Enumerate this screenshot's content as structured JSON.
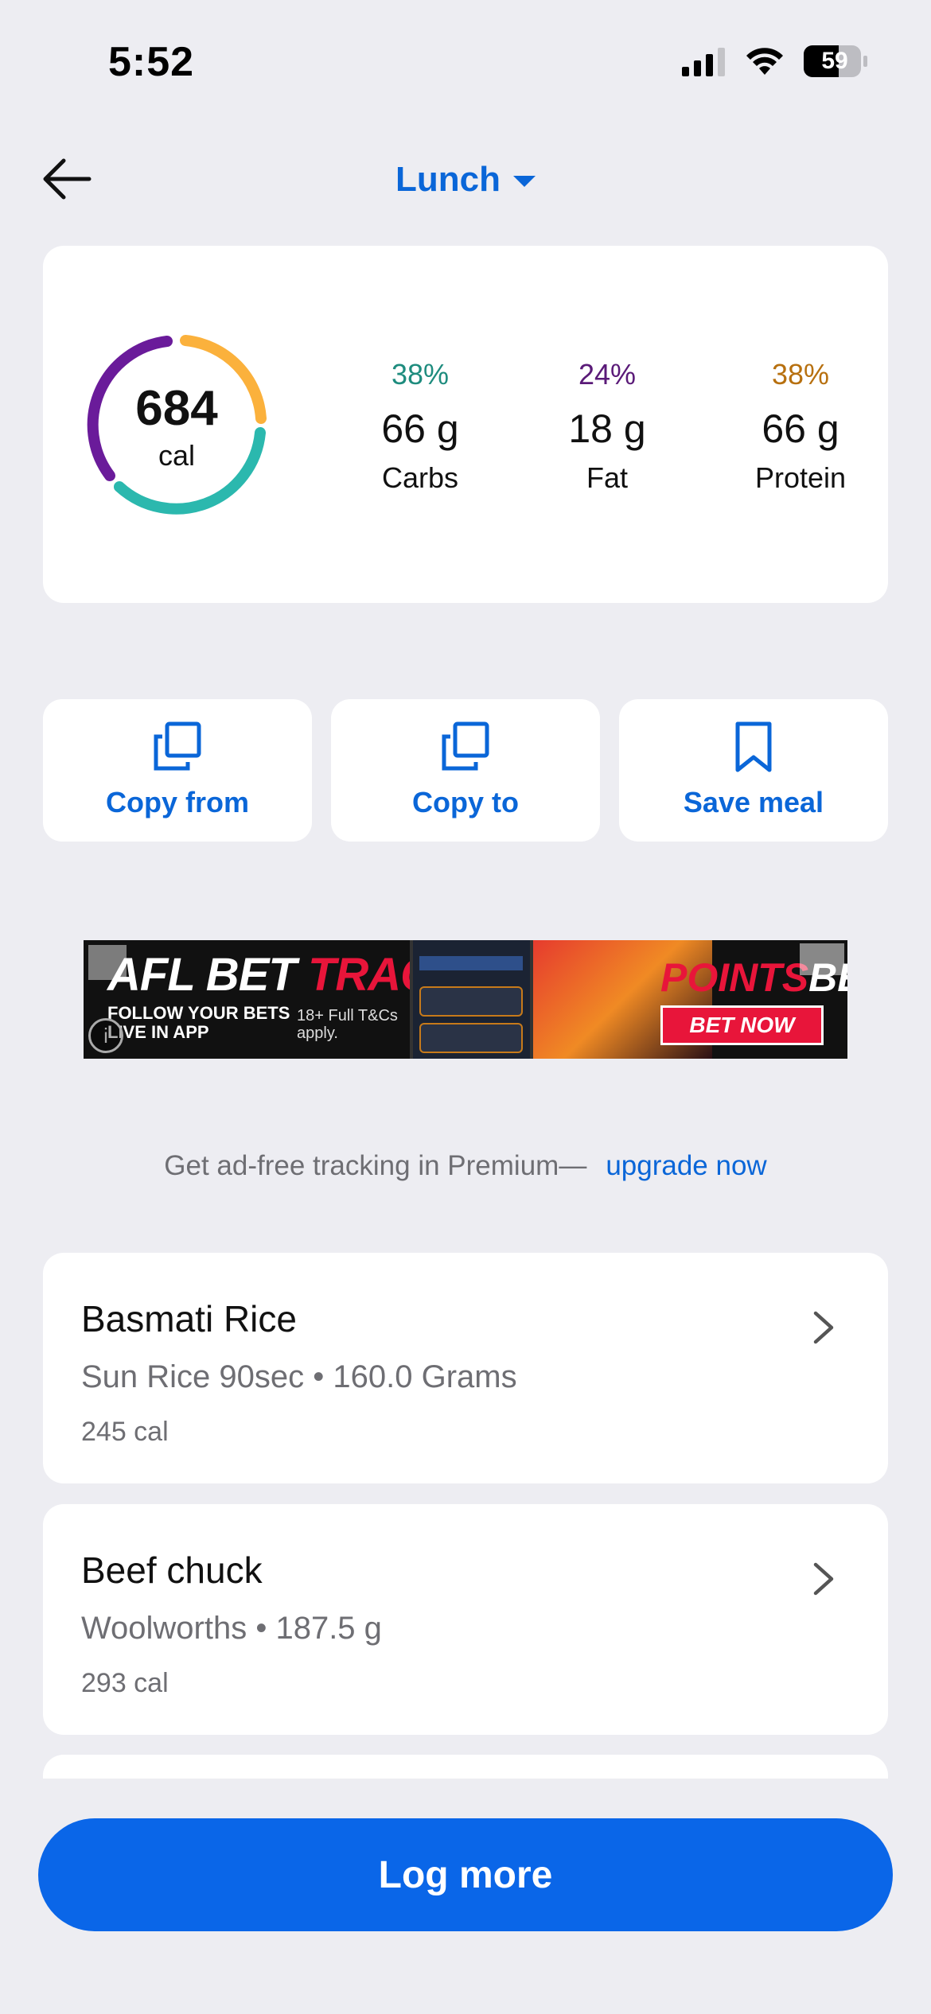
{
  "status_bar": {
    "time": "5:52",
    "battery": "59"
  },
  "header": {
    "meal_title": "Lunch"
  },
  "summary": {
    "calories": "684",
    "calories_unit": "cal",
    "macros": [
      {
        "pct": "38%",
        "value": "66 g",
        "name": "Carbs",
        "color": "#1E8C7E"
      },
      {
        "pct": "24%",
        "value": "18 g",
        "name": "Fat",
        "color": "#5A1A78"
      },
      {
        "pct": "38%",
        "value": "66 g",
        "name": "Protein",
        "color": "#B7700F"
      }
    ],
    "ring_colors": {
      "carbs": "#2BB8AE",
      "fat": "#6A1B9A",
      "protein": "#FBB13C"
    }
  },
  "actions": {
    "copy_from": "Copy from",
    "copy_to": "Copy to",
    "save_meal": "Save meal"
  },
  "ad": {
    "headline_white": "AFL BET ",
    "headline_red": "TRACKER",
    "sub": "FOLLOW YOUR BETS LIVE IN APP",
    "terms": "18+ Full T&Cs apply.",
    "brand_red": "POINTS",
    "brand_white": "BET",
    "cta": "BET NOW",
    "info": "i"
  },
  "premium": {
    "text": "Get ad-free tracking in Premium—",
    "link": "upgrade now"
  },
  "foods": [
    {
      "name": "Basmati Rice",
      "detail": "Sun Rice 90sec • 160.0 Grams",
      "calories": "245 cal"
    },
    {
      "name": "Beef chuck",
      "detail": "Woolworths • 187.5 g",
      "calories": "293 cal"
    }
  ],
  "log_more": "Log more",
  "colors": {
    "accent": "#0A66D8",
    "background": "#EDEDF2"
  }
}
